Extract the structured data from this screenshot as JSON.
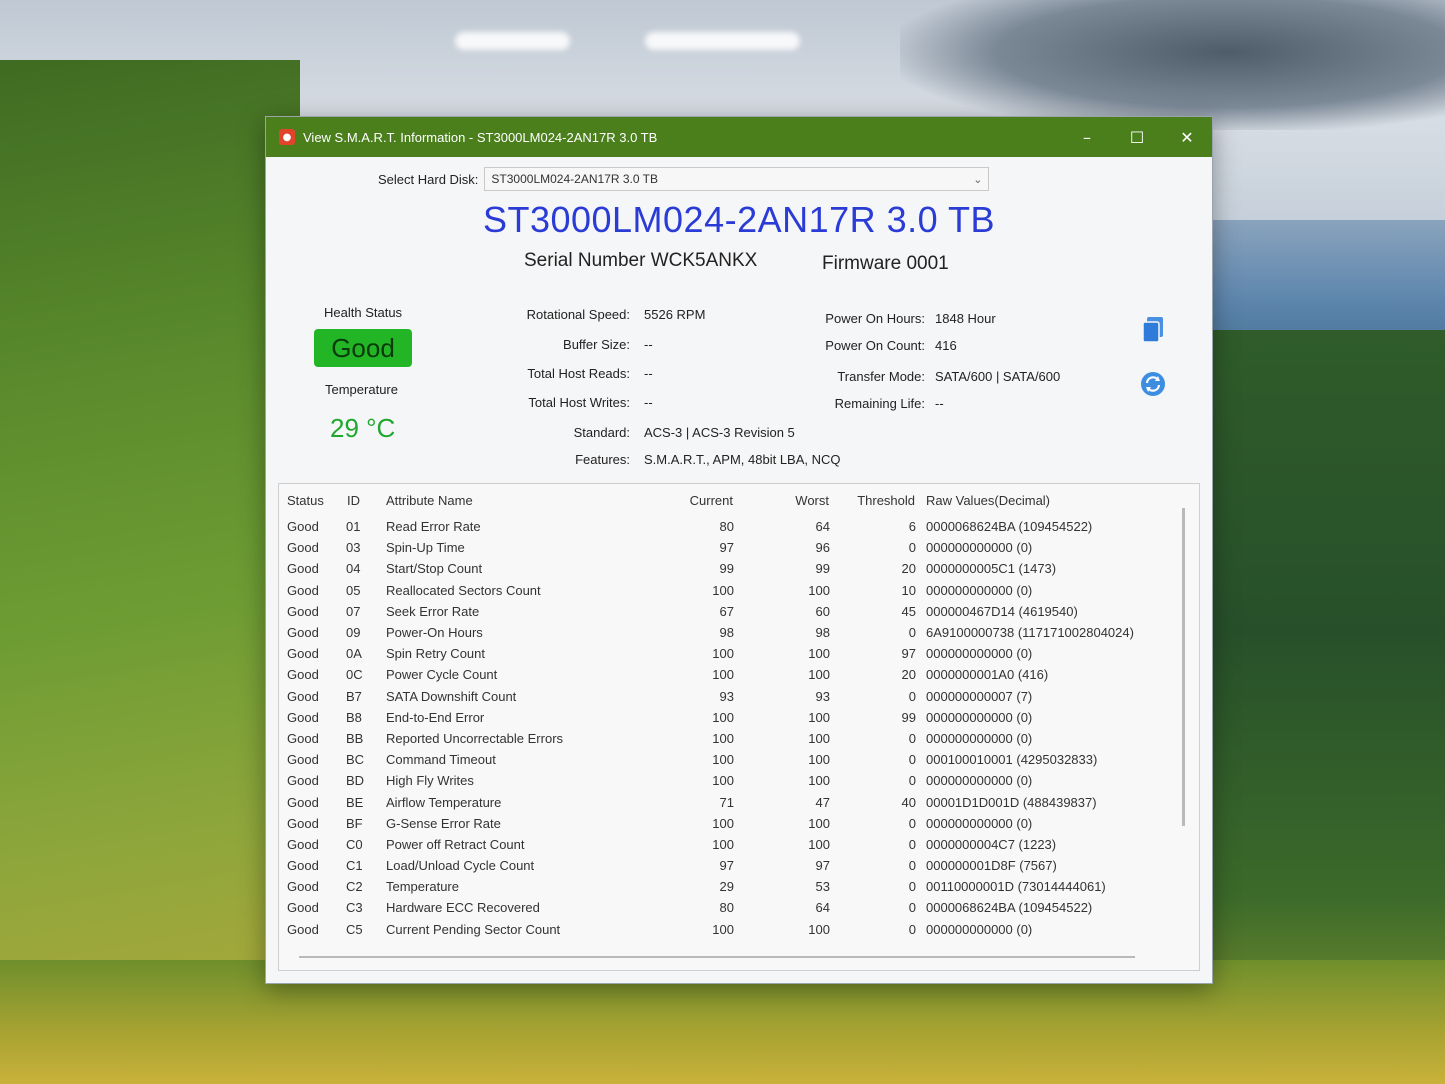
{
  "window": {
    "title": "View S.M.A.R.T. Information - ST3000LM024-2AN17R 3.0 TB",
    "minimize": "–",
    "maximize": "☐",
    "close": "✕",
    "accent": "#4a7f1c"
  },
  "disk_select": {
    "label": "Select Hard Disk:",
    "value": "ST3000LM024-2AN17R 3.0 TB"
  },
  "header": {
    "model": "ST3000LM024-2AN17R 3.0 TB",
    "serial": "Serial Number WCK5ANKX",
    "firmware": "Firmware 0001"
  },
  "health": {
    "label": "Health Status",
    "value": "Good",
    "color": "#22b525",
    "temp_label": "Temperature",
    "temp_value": "29 °C"
  },
  "info": {
    "rotational_speed": {
      "label": "Rotational Speed:",
      "value": "5526 RPM"
    },
    "buffer_size": {
      "label": "Buffer Size:",
      "value": "--"
    },
    "total_host_reads": {
      "label": "Total Host Reads:",
      "value": "--"
    },
    "total_host_writes": {
      "label": "Total Host Writes:",
      "value": "--"
    },
    "standard": {
      "label": "Standard:",
      "value": "ACS-3 | ACS-3 Revision 5"
    },
    "features": {
      "label": "Features:",
      "value": "S.M.A.R.T., APM, 48bit LBA, NCQ"
    },
    "power_on_hours": {
      "label": "Power On Hours:",
      "value": "1848 Hour"
    },
    "power_on_count": {
      "label": "Power On Count:",
      "value": "416"
    },
    "transfer_mode": {
      "label": "Transfer Mode:",
      "value": "SATA/600 | SATA/600"
    },
    "remaining_life": {
      "label": "Remaining Life:",
      "value": "--"
    }
  },
  "icons": {
    "copy": "copy-icon",
    "refresh": "refresh-icon"
  },
  "table": {
    "headers": {
      "status": "Status",
      "id": "ID",
      "name": "Attribute Name",
      "current": "Current",
      "worst": "Worst",
      "threshold": "Threshold",
      "raw": "Raw Values(Decimal)"
    },
    "rows": [
      {
        "status": "Good",
        "id": "01",
        "name": "Read Error Rate",
        "current": "80",
        "worst": "64",
        "threshold": "6",
        "raw": "0000068624BA (109454522)"
      },
      {
        "status": "Good",
        "id": "03",
        "name": "Spin-Up Time",
        "current": "97",
        "worst": "96",
        "threshold": "0",
        "raw": "000000000000 (0)"
      },
      {
        "status": "Good",
        "id": "04",
        "name": "Start/Stop Count",
        "current": "99",
        "worst": "99",
        "threshold": "20",
        "raw": "0000000005C1 (1473)"
      },
      {
        "status": "Good",
        "id": "05",
        "name": "Reallocated Sectors Count",
        "current": "100",
        "worst": "100",
        "threshold": "10",
        "raw": "000000000000 (0)"
      },
      {
        "status": "Good",
        "id": "07",
        "name": "Seek Error Rate",
        "current": "67",
        "worst": "60",
        "threshold": "45",
        "raw": "000000467D14 (4619540)"
      },
      {
        "status": "Good",
        "id": "09",
        "name": "Power-On Hours",
        "current": "98",
        "worst": "98",
        "threshold": "0",
        "raw": "6A9100000738 (117171002804024)"
      },
      {
        "status": "Good",
        "id": "0A",
        "name": "Spin Retry Count",
        "current": "100",
        "worst": "100",
        "threshold": "97",
        "raw": "000000000000 (0)"
      },
      {
        "status": "Good",
        "id": "0C",
        "name": "Power Cycle Count",
        "current": "100",
        "worst": "100",
        "threshold": "20",
        "raw": "0000000001A0 (416)"
      },
      {
        "status": "Good",
        "id": "B7",
        "name": "SATA Downshift Count",
        "current": "93",
        "worst": "93",
        "threshold": "0",
        "raw": "000000000007 (7)"
      },
      {
        "status": "Good",
        "id": "B8",
        "name": "End-to-End Error",
        "current": "100",
        "worst": "100",
        "threshold": "99",
        "raw": "000000000000 (0)"
      },
      {
        "status": "Good",
        "id": "BB",
        "name": "Reported Uncorrectable Errors",
        "current": "100",
        "worst": "100",
        "threshold": "0",
        "raw": "000000000000 (0)"
      },
      {
        "status": "Good",
        "id": "BC",
        "name": "Command Timeout",
        "current": "100",
        "worst": "100",
        "threshold": "0",
        "raw": "000100010001 (4295032833)"
      },
      {
        "status": "Good",
        "id": "BD",
        "name": "High Fly Writes",
        "current": "100",
        "worst": "100",
        "threshold": "0",
        "raw": "000000000000 (0)"
      },
      {
        "status": "Good",
        "id": "BE",
        "name": "Airflow Temperature",
        "current": "71",
        "worst": "47",
        "threshold": "40",
        "raw": "00001D1D001D (488439837)"
      },
      {
        "status": "Good",
        "id": "BF",
        "name": "G-Sense Error Rate",
        "current": "100",
        "worst": "100",
        "threshold": "0",
        "raw": "000000000000 (0)"
      },
      {
        "status": "Good",
        "id": "C0",
        "name": "Power off Retract Count",
        "current": "100",
        "worst": "100",
        "threshold": "0",
        "raw": "0000000004C7 (1223)"
      },
      {
        "status": "Good",
        "id": "C1",
        "name": "Load/Unload Cycle Count",
        "current": "97",
        "worst": "97",
        "threshold": "0",
        "raw": "000000001D8F (7567)"
      },
      {
        "status": "Good",
        "id": "C2",
        "name": "Temperature",
        "current": "29",
        "worst": "53",
        "threshold": "0",
        "raw": "00110000001D (73014444061)"
      },
      {
        "status": "Good",
        "id": "C3",
        "name": "Hardware ECC Recovered",
        "current": "80",
        "worst": "64",
        "threshold": "0",
        "raw": "0000068624BA (109454522)"
      },
      {
        "status": "Good",
        "id": "C5",
        "name": "Current Pending Sector Count",
        "current": "100",
        "worst": "100",
        "threshold": "0",
        "raw": "000000000000 (0)"
      }
    ]
  }
}
